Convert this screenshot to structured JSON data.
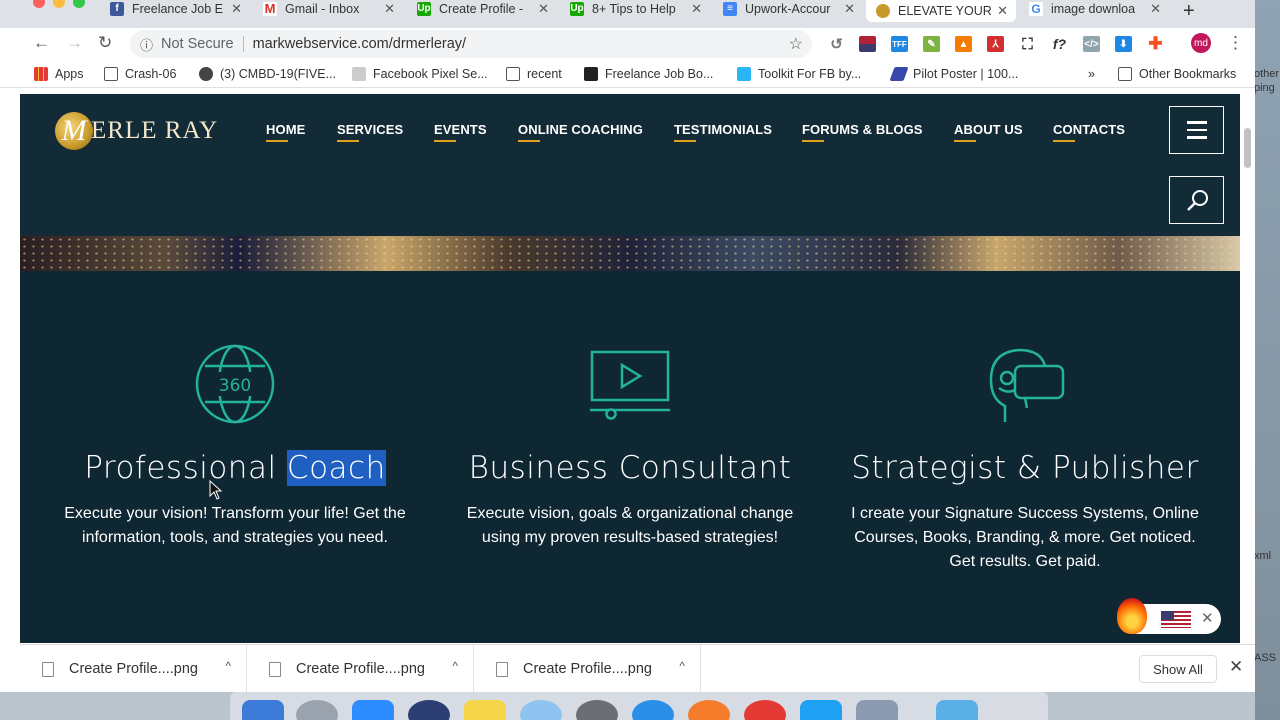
{
  "browser": {
    "tabs": [
      {
        "title": "Freelance Job E",
        "favicon": "facebook-favicon"
      },
      {
        "title": "Gmail - Inbox",
        "favicon": "gmail-favicon"
      },
      {
        "title": "Create Profile -",
        "favicon": "upwork-favicon"
      },
      {
        "title": "8+ Tips to Help",
        "favicon": "upwork-favicon"
      },
      {
        "title": "Upwork-Accour",
        "favicon": "docs-favicon"
      },
      {
        "title": "ELEVATE YOUR",
        "favicon": "site-favicon",
        "active": true
      },
      {
        "title": "image downloa",
        "favicon": "google-favicon"
      }
    ],
    "address": {
      "security": "Not Secure",
      "url": "markwebservice.com/drmerleray/"
    },
    "bookmarks": [
      {
        "label": "Apps",
        "icon": "apps-grid-icon"
      },
      {
        "label": "Crash-06",
        "icon": "folder-icon"
      },
      {
        "label": "(3) CMBD-19(FIVE...",
        "icon": "globe-icon"
      },
      {
        "label": "Facebook Pixel Se...",
        "icon": "page-icon"
      },
      {
        "label": "recent",
        "icon": "folder-icon"
      },
      {
        "label": "Freelance Job Bo...",
        "icon": "facebook-icon"
      },
      {
        "label": "Toolkit For FB by...",
        "icon": "tff-icon"
      },
      {
        "label": "Pilot Poster | 100...",
        "icon": "pilot-icon"
      },
      {
        "label": "Other Bookmarks",
        "icon": "folder-icon"
      }
    ],
    "bookmarks_more": "»"
  },
  "site": {
    "logo_text": "ERLE RAY",
    "logo_mark": "M",
    "nav": [
      "HOME",
      "SERVICES",
      "EVENTS",
      "ONLINE COACHING",
      "TESTIMONIALS",
      "FORUMS & BLOGS",
      "ABOUT US",
      "CONTACTS"
    ],
    "features": [
      {
        "icon": "globe-360-icon",
        "icon_text": "360",
        "title_main": "Professional ",
        "title_highlight": "Coach",
        "description": "Execute your vision! Transform your life! Get the information, tools, and strategies you need."
      },
      {
        "icon": "video-play-icon",
        "title_main": "Business Consultant",
        "title_highlight": "",
        "description": "Execute vision, goals & organizational change using my proven results-based strategies!"
      },
      {
        "icon": "vr-headset-icon",
        "title_main": "Strategist & Publisher",
        "title_highlight": "",
        "description": "I create your Signature Success Systems, Online Courses, Books, Branding, & more. Get noticed. Get results. Get paid."
      }
    ]
  },
  "downloads": {
    "items": [
      "Create Profile....png",
      "Create Profile....png",
      "Create Profile....png"
    ],
    "show_all": "Show All"
  },
  "desktop_right_text": [
    "other",
    "ping",
    "xml",
    "ASS"
  ],
  "colors": {
    "page_bg": "#0f2633",
    "accent_teal": "#23b39b",
    "nav_underline": "#e0a11c",
    "selection": "#1f5fc2"
  }
}
